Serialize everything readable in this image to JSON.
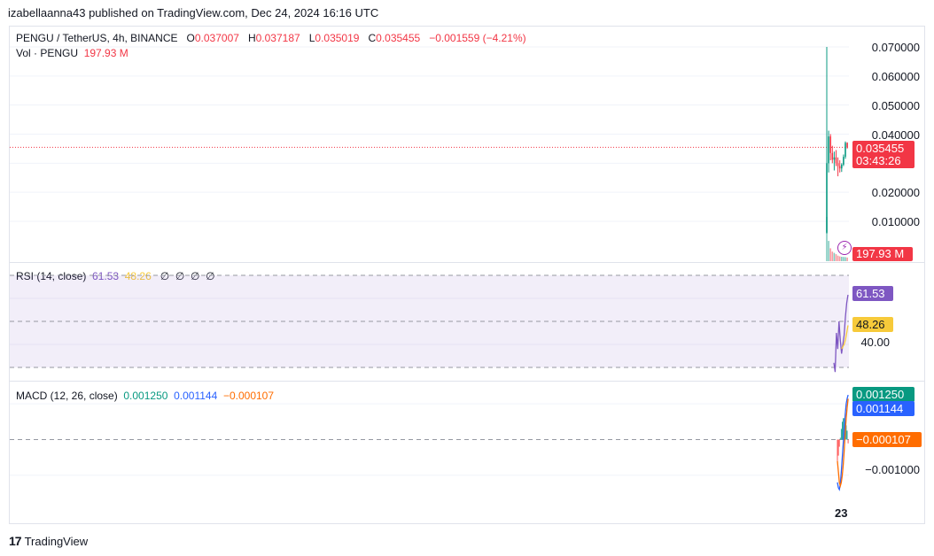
{
  "header": {
    "publisher_text": "izabellaanna43 published on TradingView.com, Dec 24, 2024 16:16 UTC"
  },
  "main_legend": {
    "symbol": "PENGU / TetherUS, 4h, BINANCE",
    "o_label": "O",
    "o_value": "0.037007",
    "h_label": "H",
    "h_value": "0.037187",
    "l_label": "L",
    "l_value": "0.035019",
    "c_label": "C",
    "c_value": "0.035455",
    "change": "−0.001559 (−4.21%)"
  },
  "vol_legend": {
    "label": "Vol · PENGU",
    "value": "197.93 M"
  },
  "rsi_legend": {
    "label": "RSI (14, close)",
    "value1": "61.53",
    "value2": "48.26",
    "na": [
      "∅",
      "∅",
      "∅",
      "∅"
    ]
  },
  "macd_legend": {
    "label": "MACD (12, 26, close)",
    "macd": "0.001250",
    "signal": "0.001144",
    "hist": "−0.000107"
  },
  "price_axis": {
    "ticks": [
      "0.070000",
      "0.060000",
      "0.050000",
      "0.040000",
      "0.020000",
      "0.010000"
    ],
    "last_price": "0.035455",
    "countdown": "03:43:26",
    "vol_badge": "197.93 M"
  },
  "rsi_axis": {
    "badge1": "61.53",
    "badge2": "48.26",
    "tick": "40.00"
  },
  "macd_axis": {
    "badge_macd": "0.001250",
    "badge_signal": "0.001144",
    "badge_hist": "−0.000107",
    "tick": "−0.001000"
  },
  "time_axis": {
    "label": "23"
  },
  "brand": {
    "name": "TradingView"
  },
  "colors": {
    "up": "#089981",
    "down": "#f23645",
    "rsi": "#7e57c2",
    "rsi_ma": "#f7ca3a",
    "macd": "#2962ff",
    "signal": "#ff6d00",
    "hist": "#26a69a"
  },
  "chart_data": [
    {
      "type": "candlestick",
      "title": "PENGU / TetherUS, 4h, BINANCE",
      "x": [
        "23"
      ],
      "ylim": [
        0,
        0.075
      ],
      "y_ticks": [
        0.07,
        0.06,
        0.05,
        0.04,
        0.02,
        0.01
      ],
      "last_ohlc": {
        "open": 0.037007,
        "high": 0.037187,
        "low": 0.035019,
        "close": 0.035455
      },
      "candles": [
        {
          "o": 0.0061,
          "h": 0.07,
          "l": 0.0058,
          "c": 0.03
        },
        {
          "o": 0.03,
          "h": 0.0412,
          "l": 0.0268,
          "c": 0.0392
        },
        {
          "o": 0.0392,
          "h": 0.04,
          "l": 0.031,
          "c": 0.0335
        },
        {
          "o": 0.0335,
          "h": 0.036,
          "l": 0.03,
          "c": 0.0312
        },
        {
          "o": 0.0312,
          "h": 0.034,
          "l": 0.0275,
          "c": 0.032
        },
        {
          "o": 0.032,
          "h": 0.0345,
          "l": 0.029,
          "c": 0.03
        },
        {
          "o": 0.03,
          "h": 0.032,
          "l": 0.0255,
          "c": 0.029
        },
        {
          "o": 0.029,
          "h": 0.031,
          "l": 0.0268,
          "c": 0.0282
        },
        {
          "o": 0.0282,
          "h": 0.03,
          "l": 0.027,
          "c": 0.0295
        },
        {
          "o": 0.0295,
          "h": 0.033,
          "l": 0.029,
          "c": 0.0322
        },
        {
          "o": 0.0322,
          "h": 0.0375,
          "l": 0.0315,
          "c": 0.037
        },
        {
          "o": 0.037007,
          "h": 0.037187,
          "l": 0.035019,
          "c": 0.035455
        }
      ]
    },
    {
      "type": "bar",
      "title": "Vol · PENGU",
      "values": [
        2400,
        1100,
        700,
        520,
        450,
        380,
        300,
        260,
        240,
        230,
        220,
        197.93
      ],
      "unit": "M"
    },
    {
      "type": "line",
      "title": "RSI (14, close)",
      "ylim": [
        25,
        75
      ],
      "bands": [
        70,
        50,
        30
      ],
      "y_ticks": [
        40
      ],
      "series": [
        {
          "name": "RSI",
          "values": [
            32,
            28,
            45,
            38,
            50,
            42,
            36,
            40,
            44,
            52,
            58,
            61.53
          ]
        },
        {
          "name": "MA",
          "values": [
            null,
            null,
            null,
            null,
            null,
            null,
            38,
            39,
            40,
            42,
            45,
            48.26
          ]
        }
      ]
    },
    {
      "type": "line",
      "title": "MACD (12, 26, close)",
      "ylim": [
        -0.0017,
        0.0016
      ],
      "zero_line": 0,
      "y_ticks": [
        -0.001
      ],
      "series": [
        {
          "name": "MACD",
          "values": [
            -0.0012,
            -0.00135,
            -0.0014,
            -0.00125,
            -0.0009,
            -0.0005,
            -0.0001,
            0.0003,
            0.0007,
            0.001,
            0.00115,
            0.00125
          ]
        },
        {
          "name": "Signal",
          "values": [
            -0.0006,
            -0.0009,
            -0.0012,
            -0.0013,
            -0.0012,
            -0.001,
            -0.0007,
            -0.0003,
            0.0002,
            0.0006,
            0.0009,
            0.001144
          ]
        },
        {
          "name": "Histogram",
          "values": [
            -0.0006,
            -0.00045,
            -0.0002,
            5e-05,
            0.0003,
            0.0005,
            0.0006,
            0.0006,
            0.0005,
            0.0004,
            0.00025,
            -0.000107
          ]
        }
      ]
    }
  ]
}
